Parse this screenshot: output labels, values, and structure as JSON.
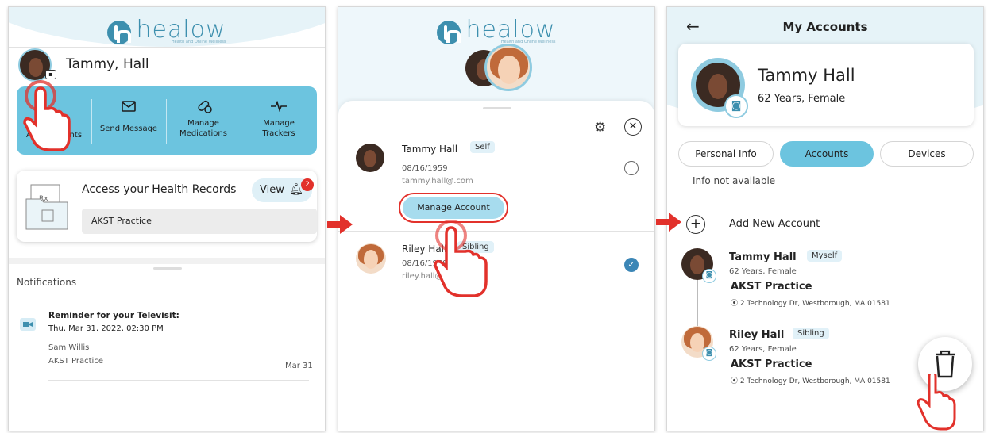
{
  "panel1": {
    "logo": "healow",
    "logo_sub": "Health and Online Wellness",
    "user_name": "Tammy, Hall",
    "actions": [
      {
        "label": "Appointments",
        "icon": "calendar-icon"
      },
      {
        "label": "Send Message",
        "icon": "mail-icon"
      },
      {
        "label": "Manage Medications",
        "icon": "pill-icon"
      },
      {
        "label": "Manage Trackers",
        "icon": "heartbeat-icon"
      }
    ],
    "health_records": {
      "title": "Access your Health Records",
      "view_label": "View",
      "badge": "2",
      "practice": "AKST Practice"
    },
    "notifications": {
      "heading": "Notifications",
      "item": {
        "title": "Reminder for your Televisit:",
        "datetime": "Thu, Mar 31, 2022, 02:30 PM",
        "doctor": "Sam Willis",
        "practice": "AKST Practice",
        "date": "Mar 31"
      }
    }
  },
  "panel2": {
    "logo": "healow",
    "logo_sub": "Health and Online Wellness",
    "accounts": [
      {
        "name": "Tammy Hall",
        "tag": "Self",
        "dob": "08/16/1959",
        "email": "tammy.hall@.com",
        "selected": false
      },
      {
        "name": "Riley Hall",
        "tag": "Sibling",
        "dob": "08/16/1959",
        "email": "riley.hall@.com",
        "selected": true
      }
    ],
    "manage_label": "Manage Account"
  },
  "panel3": {
    "title": "My Accounts",
    "profile": {
      "name": "Tammy Hall",
      "details": "62 Years, Female"
    },
    "tabs": [
      "Personal Info",
      "Accounts",
      "Devices"
    ],
    "active_tab": "Accounts",
    "info_text": "Info not available",
    "add_label": "Add New Account",
    "linked": [
      {
        "name": "Tammy Hall",
        "tag": "Myself",
        "details": "62 Years, Female",
        "practice": "AKST Practice",
        "address": "2 Technology Dr, Westborough, MA 01581"
      },
      {
        "name": "Riley Hall",
        "tag": "Sibling",
        "details": "62 Years, Female",
        "practice": "AKST Practice",
        "address": "2 Technology Dr, Westborough, MA 01581"
      }
    ]
  },
  "colors": {
    "brand": "#3d8fae",
    "panel": "#6cc4df",
    "accent_red": "#e2312b",
    "check": "#3b86b6"
  }
}
